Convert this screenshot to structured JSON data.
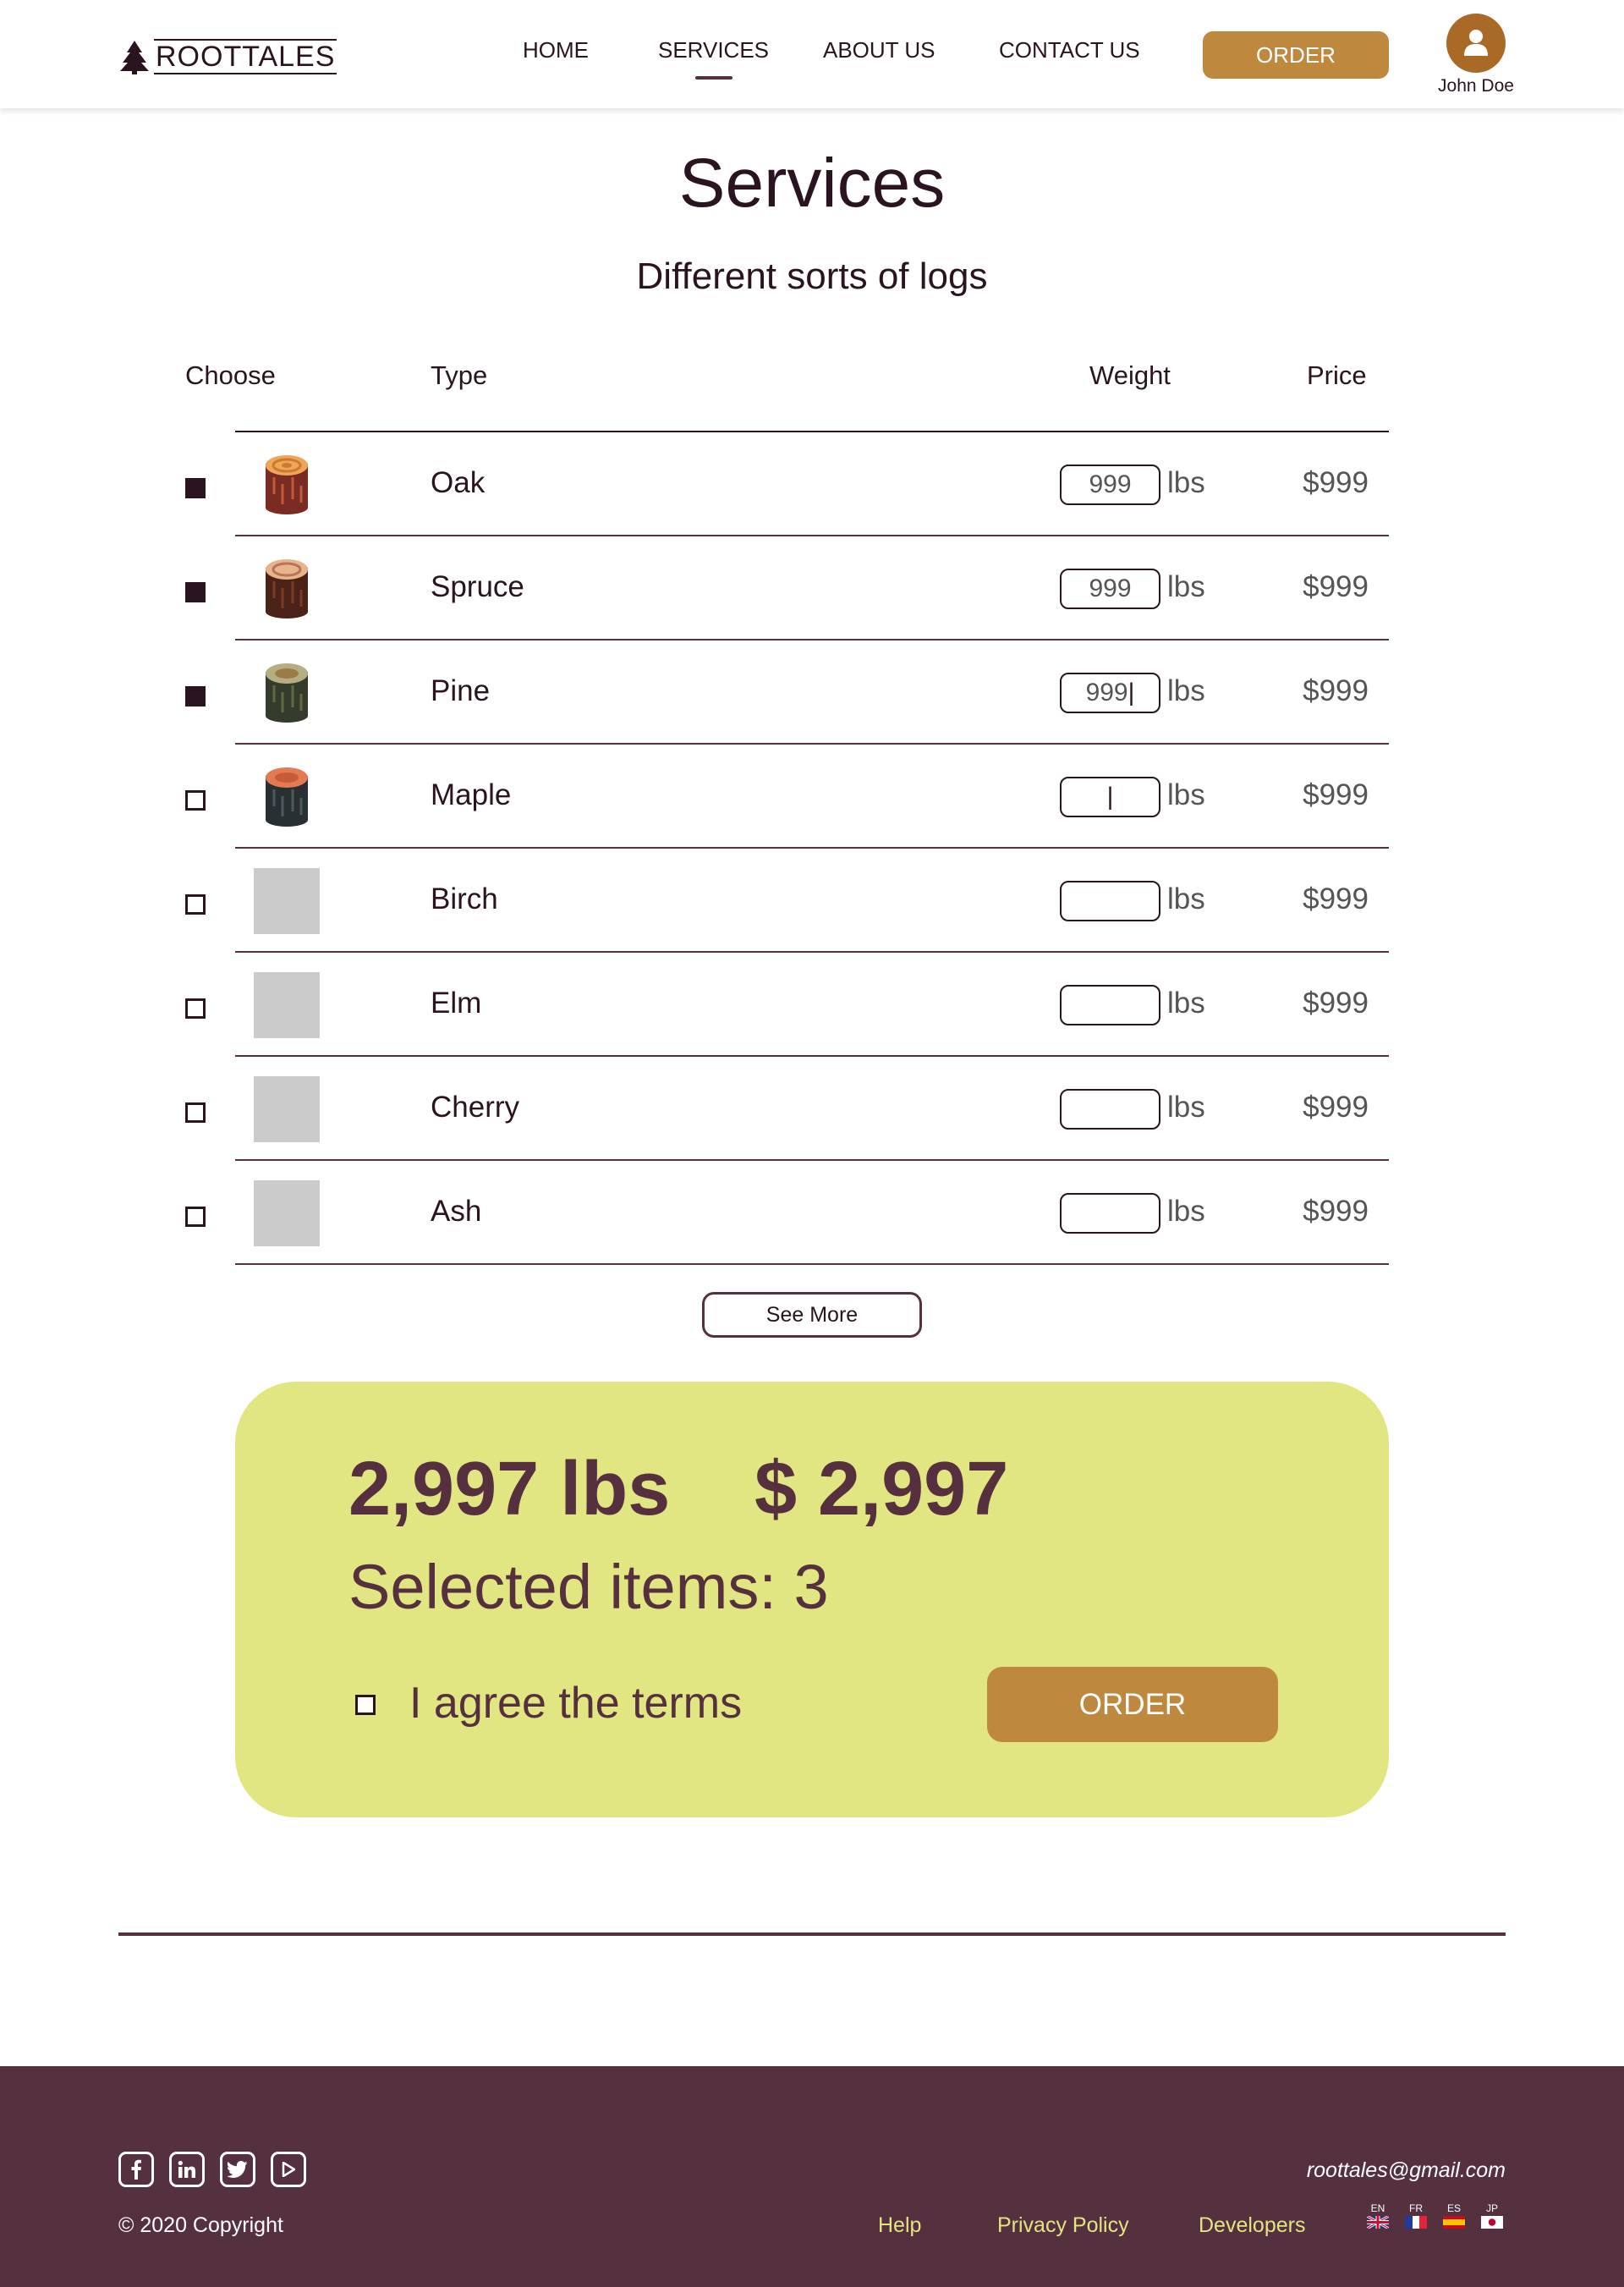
{
  "header": {
    "logo_text": "ROOTTALES",
    "nav": [
      {
        "label": "HOME",
        "active": false
      },
      {
        "label": "SERVICES",
        "active": true
      },
      {
        "label": "ABOUT US",
        "active": false
      },
      {
        "label": "CONTACT US",
        "active": false
      }
    ],
    "order_label": "ORDER",
    "user_name": "John Doe",
    "icons": {
      "logo": "pine-tree-icon",
      "avatar": "user-icon"
    }
  },
  "page": {
    "title": "Services",
    "subtitle": "Different sorts of logs"
  },
  "table": {
    "headers": {
      "choose": "Choose",
      "type": "Type",
      "weight": "Weight",
      "price": "Price"
    },
    "unit": "lbs",
    "rows": [
      {
        "type": "Oak",
        "checked": true,
        "weight": "999",
        "price": "$999",
        "thumb": "oak-log-icon"
      },
      {
        "type": "Spruce",
        "checked": true,
        "weight": "999",
        "price": "$999",
        "thumb": "spruce-log-icon"
      },
      {
        "type": "Pine",
        "checked": true,
        "weight": "999",
        "price": "$999",
        "thumb": "pine-log-icon"
      },
      {
        "type": "Maple",
        "checked": false,
        "weight": "",
        "price": "$999",
        "thumb": "maple-log-icon"
      },
      {
        "type": "Birch",
        "checked": false,
        "weight": "",
        "price": "$999",
        "thumb": "image-placeholder"
      },
      {
        "type": "Elm",
        "checked": false,
        "weight": "",
        "price": "$999",
        "thumb": "image-placeholder"
      },
      {
        "type": "Cherry",
        "checked": false,
        "weight": "",
        "price": "$999",
        "thumb": "image-placeholder"
      },
      {
        "type": "Ash",
        "checked": false,
        "weight": "",
        "price": "$999",
        "thumb": "image-placeholder"
      }
    ],
    "see_more_label": "See More"
  },
  "summary": {
    "total_weight": "2,997 lbs",
    "total_price": "$ 2,997",
    "selected_items": "Selected items: 3",
    "agree_label": "I agree the terms",
    "order_label": "ORDER"
  },
  "footer": {
    "socials": [
      "facebook-icon",
      "linkedin-icon",
      "twitter-icon",
      "youtube-icon"
    ],
    "copyright": "© 2020 Copyright",
    "email": "roottales@gmail.com",
    "links": [
      "Help",
      "Privacy Policy",
      "Developers"
    ],
    "languages": [
      "EN",
      "FR",
      "ES",
      "JP"
    ]
  },
  "colors": {
    "primary_dark": "#2a1420",
    "plum": "#56303f",
    "accent_gold": "#bf883f",
    "summary_bg": "#e1e582",
    "footer_link": "#e1e582"
  }
}
